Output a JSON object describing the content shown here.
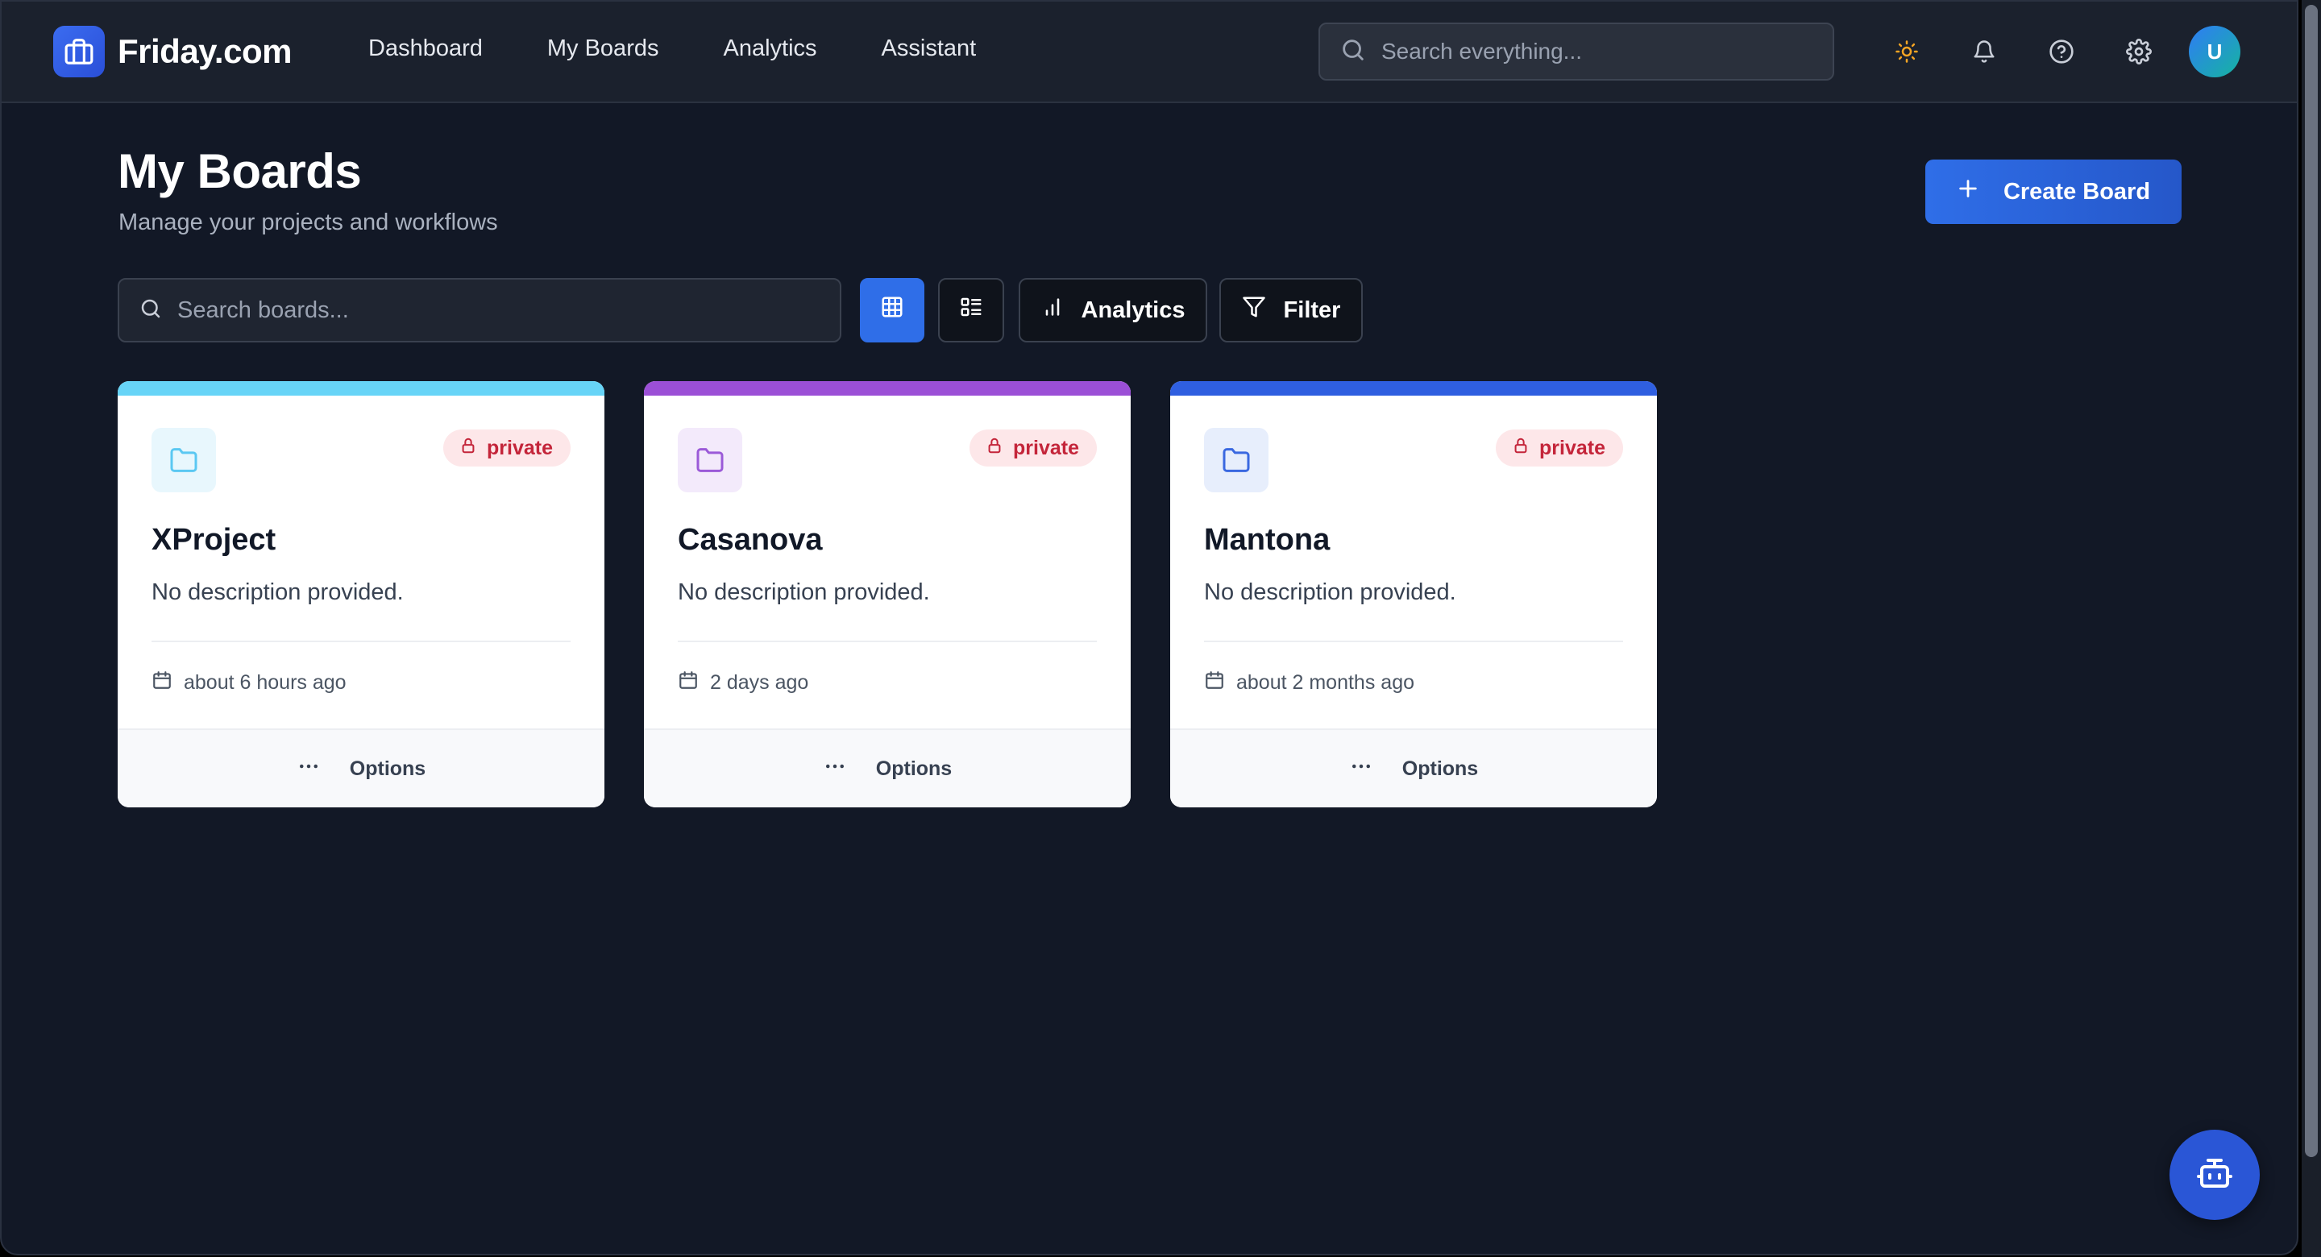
{
  "app": {
    "name": "Friday.com"
  },
  "nav": {
    "links": [
      "Dashboard",
      "My Boards",
      "Analytics",
      "Assistant"
    ],
    "search_placeholder": "Search everything...",
    "avatar_initial": "U"
  },
  "header": {
    "title": "My Boards",
    "subtitle": "Manage your projects and workflows",
    "create_label": "Create Board"
  },
  "toolbar": {
    "search_placeholder": "Search boards...",
    "analytics_label": "Analytics",
    "filter_label": "Filter",
    "active_view": "grid"
  },
  "boards": [
    {
      "title": "XProject",
      "description": "No description provided.",
      "visibility": "private",
      "updated": "about 6 hours ago",
      "options_label": "Options",
      "accent": "#67d4f7",
      "icon_bg": "#e8f7fd",
      "icon_color": "#5bc8f2"
    },
    {
      "title": "Casanova",
      "description": "No description provided.",
      "visibility": "private",
      "updated": "2 days ago",
      "options_label": "Options",
      "accent": "#9b4fd6",
      "icon_bg": "#f3eafb",
      "icon_color": "#9b5ad8"
    },
    {
      "title": "Mantona",
      "description": "No description provided.",
      "visibility": "private",
      "updated": "about 2 months ago",
      "options_label": "Options",
      "accent": "#2f5fe0",
      "icon_bg": "#e7eefc",
      "icon_color": "#3a68e0"
    }
  ],
  "colors": {
    "background": "#121826",
    "nav_bg": "#1b212d",
    "primary": "#2f6ee8",
    "badge_bg": "#fde7e9",
    "badge_text": "#c4253a"
  },
  "icons": {
    "logo": "briefcase-icon",
    "theme": "sun-icon",
    "notifications": "bell-icon",
    "help": "help-circle-icon",
    "settings": "gear-icon",
    "fab": "robot-icon"
  }
}
